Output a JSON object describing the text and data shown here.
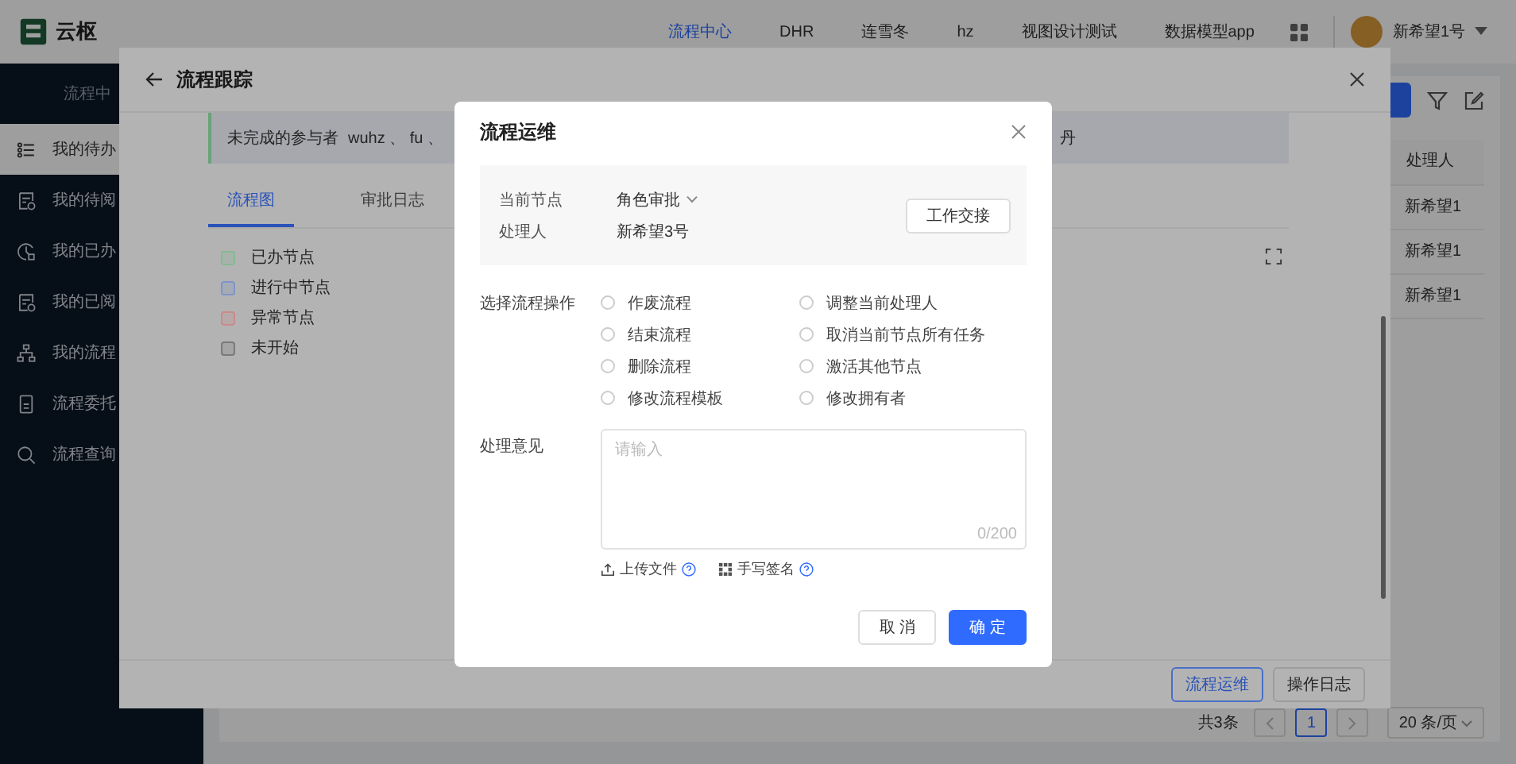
{
  "top_nav": {
    "logo": "云枢",
    "items": [
      {
        "label": "流程中心",
        "selected": true
      },
      {
        "label": "DHR",
        "selected": false
      },
      {
        "label": "连雪冬",
        "selected": false
      },
      {
        "label": "hz",
        "selected": false
      },
      {
        "label": "视图设计测试",
        "selected": false
      },
      {
        "label": "数据模型app",
        "selected": false
      }
    ],
    "user": "新希望1号"
  },
  "sidebar": {
    "title": "流程中",
    "items": [
      {
        "label": "我的待办",
        "kind": "list",
        "selected": true
      },
      {
        "label": "我的待阅",
        "kind": "doc",
        "selected": false
      },
      {
        "label": "我的已办",
        "kind": "clock",
        "selected": false
      },
      {
        "label": "我的已阅",
        "kind": "doc",
        "selected": false
      },
      {
        "label": "我的流程",
        "kind": "tree",
        "selected": false
      },
      {
        "label": "流程委托",
        "kind": "phone",
        "selected": false
      },
      {
        "label": "流程查询",
        "kind": "search",
        "selected": false
      }
    ]
  },
  "table": {
    "columns": [
      "处理人"
    ],
    "rows": [
      [
        "新希望1"
      ],
      [
        "新希望1"
      ],
      [
        "新希望1"
      ]
    ]
  },
  "pagination": {
    "total": "共3条",
    "pages": [
      {
        "label": "1",
        "selected": true
      }
    ],
    "page_size": "20 条/页"
  },
  "drawer": {
    "title": "流程跟踪",
    "info_label": "未完成的参与者",
    "participants": "wuhz 、 fu 、",
    "participants_tail": "丹",
    "tabs": [
      {
        "label": "流程图",
        "selected": true
      },
      {
        "label": "审批日志",
        "selected": false
      }
    ],
    "legend": [
      {
        "label": "已办节点",
        "color": "#86b893"
      },
      {
        "label": "进行中节点",
        "color": "#7f94c8"
      },
      {
        "label": "异常节点",
        "color": "#c98a8a"
      },
      {
        "label": "未开始",
        "color": "#7a7a7a"
      }
    ],
    "footer_buttons": [
      {
        "label": "流程运维",
        "kind": "primary"
      },
      {
        "label": "操作日志",
        "kind": "default"
      }
    ]
  },
  "dialog": {
    "title": "流程运维",
    "current_node_label": "当前节点",
    "current_node": "角色审批",
    "handler_label": "处理人",
    "handler": "新希望3号",
    "handover_button": "工作交接",
    "operations_label": "选择流程操作",
    "operations": [
      {
        "label": "作废流程",
        "selected": false
      },
      {
        "label": "调整当前处理人",
        "selected": false
      },
      {
        "label": "结束流程",
        "selected": false
      },
      {
        "label": "取消当前节点所有任务",
        "selected": false
      },
      {
        "label": "删除流程",
        "selected": false
      },
      {
        "label": "激活其他节点",
        "selected": false
      },
      {
        "label": "修改流程模板",
        "selected": false
      },
      {
        "label": "修改拥有者",
        "selected": false
      }
    ],
    "comment_label": "处理意见",
    "comment": {
      "placeholder": "请输入",
      "count": "0/200"
    },
    "links": [
      {
        "label": "上传文件",
        "kind": "upload"
      },
      {
        "label": "手写签名",
        "kind": "grid"
      }
    ],
    "buttons": [
      {
        "label": "取 消",
        "kind": "default"
      },
      {
        "label": "确 定",
        "kind": "primary"
      }
    ]
  }
}
